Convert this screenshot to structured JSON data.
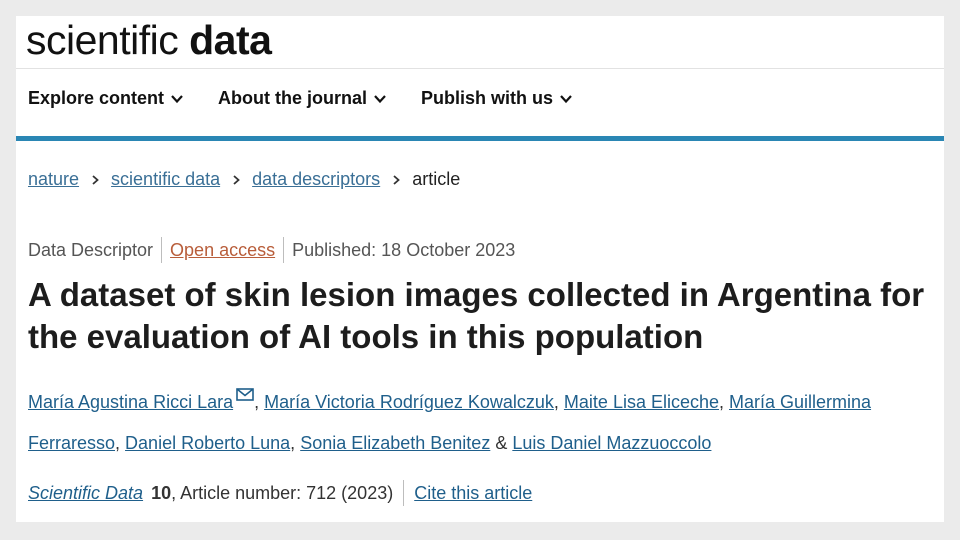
{
  "brand": {
    "light": "scientific",
    "bold": "data"
  },
  "nav": [
    {
      "label": "Explore content"
    },
    {
      "label": "About the journal"
    },
    {
      "label": "Publish with us"
    }
  ],
  "breadcrumb": {
    "items": [
      "nature",
      "scientific data",
      "data descriptors"
    ],
    "current": "article"
  },
  "meta": {
    "type": "Data Descriptor",
    "access": "Open access",
    "published": "Published: 18 October 2023"
  },
  "title": "A dataset of skin lesion images collected in Argentina for the evaluation of AI tools in this population",
  "authors": [
    "María Agustina Ricci Lara",
    "María Victoria Rodríguez Kowalczuk",
    "Maite Lisa Eliceche",
    "María Guillermina Ferraresso",
    "Daniel Roberto Luna",
    "Sonia Elizabeth Benitez",
    "Luis Daniel Mazzuoccolo"
  ],
  "citation": {
    "journal": "Scientific Data",
    "volume": "10",
    "article": ", Article number: 712 (2023)",
    "cite_label": "Cite this article"
  },
  "colors": {
    "accent_rule": "#2a86b4",
    "link": "#1f5f8b",
    "open_access": "#b85d3a",
    "background": "#ebebeb"
  }
}
